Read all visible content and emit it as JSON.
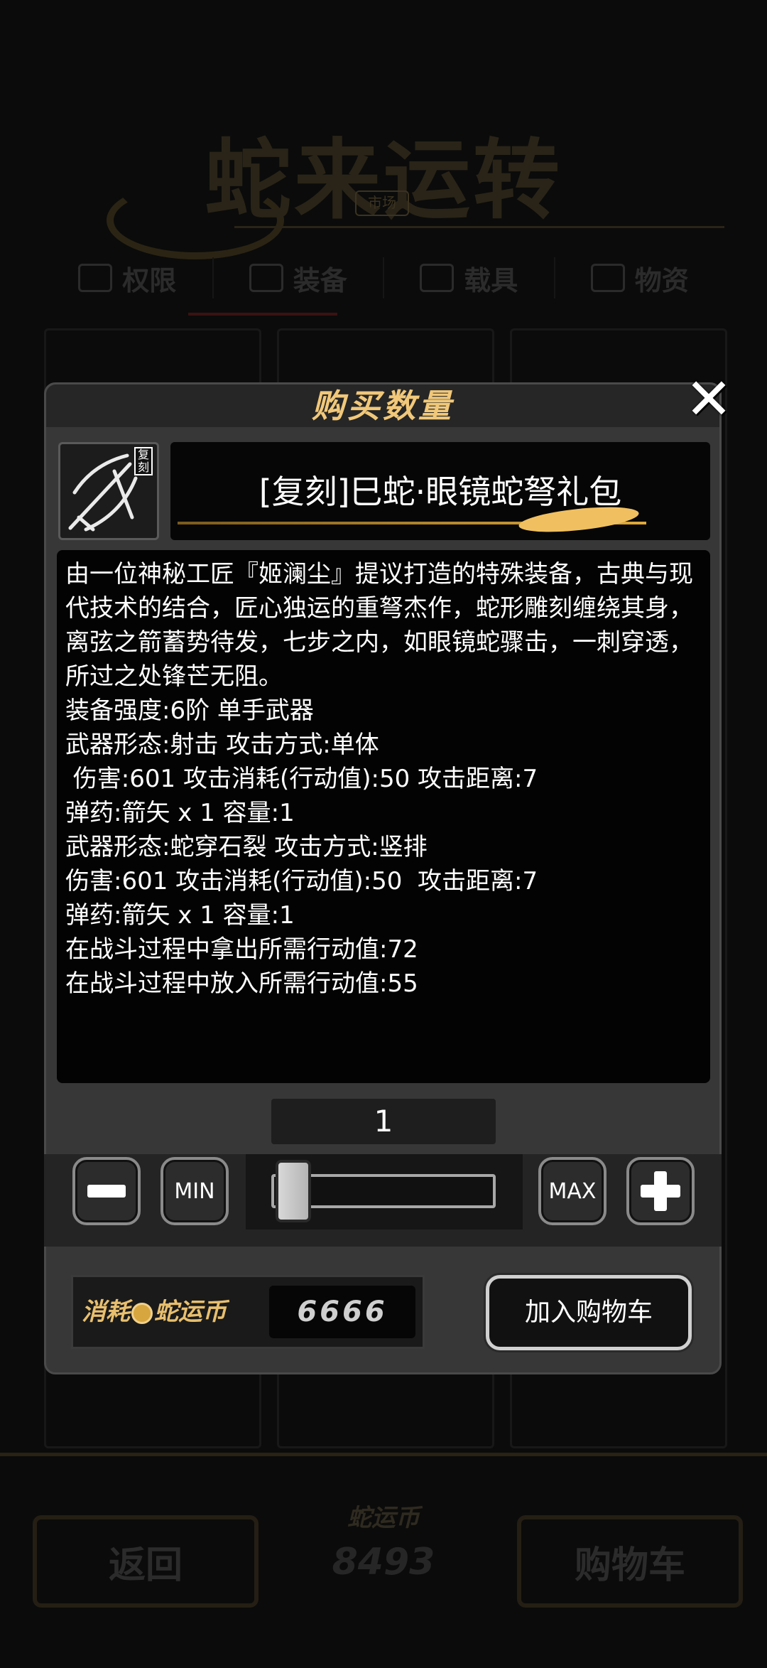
{
  "background": {
    "title": "蛇来运转",
    "badge": "市场",
    "tabs": [
      "权限",
      "装备",
      "载具",
      "物资"
    ],
    "back_label": "返回",
    "coin_label": "蛇运币",
    "coin_balance": "8493",
    "cart_label": "购物车"
  },
  "modal": {
    "title": "购买数量",
    "close_icon": "close-icon",
    "item": {
      "tag": "复刻",
      "name": "[复刻]巳蛇·眼镜蛇弩礼包",
      "thumbnail_icon": "crossbow-icon"
    },
    "description": "由一位神秘工匠『姬澜尘』提议打造的特殊装备，古典与现代技术的结合，匠心独运的重弩杰作，蛇形雕刻缠绕其身，离弦之箭蓄势待发，七步之内，如眼镜蛇骤击，一刺穿透，所过之处锋芒无阻。",
    "stats": [
      "装备强度:6阶 单手武器",
      "武器形态:射击 攻击方式:单体",
      " 伤害:601 攻击消耗(行动值):50 攻击距离:7",
      "弹药:箭矢 x 1 容量:1",
      "武器形态:蛇穿石裂 攻击方式:竖排",
      "伤害:601 攻击消耗(行动值):50  攻击距离:7",
      "弹药:箭矢 x 1 容量:1",
      "在战斗过程中拿出所需行动值:72",
      "在战斗过程中放入所需行动值:55"
    ],
    "quantity": "1",
    "min_label": "MIN",
    "max_label": "MAX",
    "slider_level": 0,
    "cost_label_pre": "消耗",
    "cost_label_post": "蛇运币",
    "cost_value": "6666",
    "add_to_cart_label": "加入购物车",
    "colors": {
      "accent_gold": "#f1c87a",
      "panel": "#373737"
    }
  }
}
